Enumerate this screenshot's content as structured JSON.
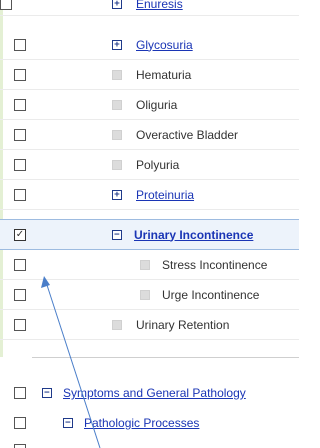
{
  "tree": {
    "rows": [
      {
        "label": "Enuresis",
        "checked": false,
        "node": "expandable",
        "link": true
      },
      {
        "label": "Glycosuria",
        "checked": false,
        "node": "expandable",
        "link": true
      },
      {
        "label": "Hematuria",
        "checked": false,
        "node": "leaf",
        "link": false
      },
      {
        "label": "Oliguria",
        "checked": false,
        "node": "leaf",
        "link": false
      },
      {
        "label": "Overactive Bladder",
        "checked": false,
        "node": "leaf",
        "link": false
      },
      {
        "label": "Polyuria",
        "checked": false,
        "node": "leaf",
        "link": false
      },
      {
        "label": "Proteinuria",
        "checked": false,
        "node": "expandable",
        "link": true
      },
      {
        "label": "Urinary Incontinence",
        "checked": true,
        "node": "expanded",
        "link": true
      },
      {
        "label": "Stress Incontinence",
        "checked": false,
        "node": "leaf",
        "link": false
      },
      {
        "label": "Urge Incontinence",
        "checked": false,
        "node": "leaf",
        "link": false
      },
      {
        "label": "Urinary Retention",
        "checked": false,
        "node": "leaf",
        "link": false
      },
      {
        "label": "Symptoms and General Pathology",
        "checked": false,
        "node": "expanded",
        "link": true
      },
      {
        "label": "Pathologic Processes",
        "checked": false,
        "node": "expanded",
        "link": true
      }
    ]
  },
  "glyphs": {
    "expand": "+",
    "collapse": "−",
    "checkmark": "✓"
  },
  "colors": {
    "link": "#1a35b5",
    "selected_bg": "#edf3fb",
    "selected_border": "#9dbbe0",
    "arrow": "#4a7ec9"
  }
}
